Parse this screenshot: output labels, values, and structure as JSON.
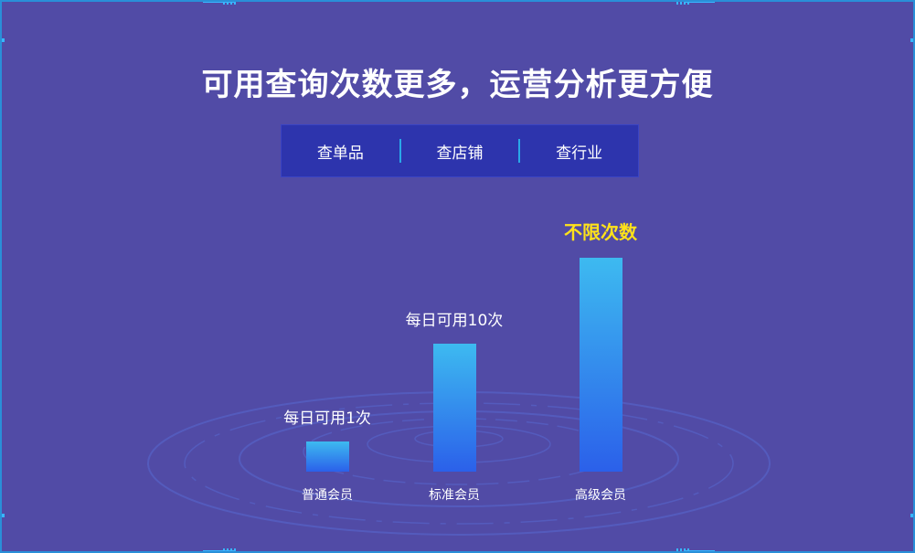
{
  "title": "可用查询次数更多，运营分析更方便",
  "tabs": [
    "查单品",
    "查店铺",
    "查行业"
  ],
  "chart_data": {
    "type": "bar",
    "categories": [
      "普通会员",
      "标准会员",
      "高级会员"
    ],
    "data_labels": [
      "每日可用1次",
      "每日可用10次",
      "不限次数"
    ],
    "value_annotations": [
      "每日可用1次",
      "每日可用10次",
      "不限次数"
    ],
    "relative_level": [
      0.14,
      0.6,
      1.0
    ],
    "highlight_color": "#ffe21a",
    "bar_gradient": [
      "#3dbaf0",
      "#2b60ea"
    ]
  },
  "colors": {
    "background": "#514ba6",
    "tab_bar": "#2d34ad",
    "accent": "#29a8e8"
  }
}
